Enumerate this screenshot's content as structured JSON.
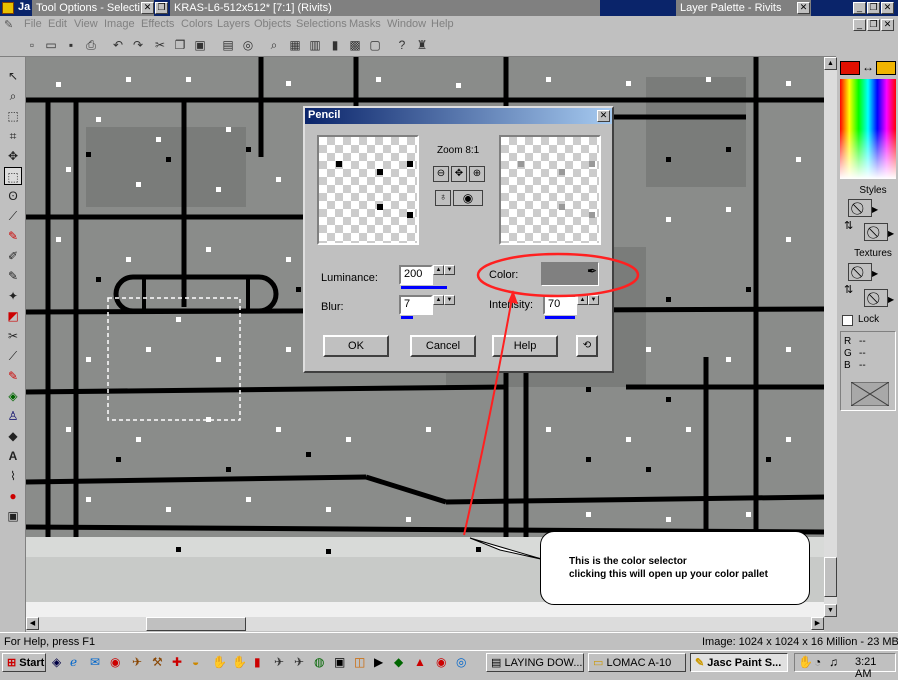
{
  "app_title": "Ja",
  "tool_options_title": "Tool Options - Selecti",
  "document_title": "KRAS-L6-512x512* [7:1] (Rivits)",
  "layer_palette_title": "Layer Palette - Rivits",
  "menu": [
    "File",
    "Edit",
    "View",
    "Image",
    "Effects",
    "Colors",
    "Layers",
    "Objects",
    "Selections",
    "Masks",
    "Window",
    "Help"
  ],
  "palette": {
    "styles_label": "Styles",
    "textures_label": "Textures",
    "lock_label": "Lock",
    "rgb_labels": [
      "R",
      "G",
      "B"
    ],
    "rgb_values": [
      "--",
      "--",
      "--"
    ],
    "foreground_color": "#e01000",
    "background_color": "#f0b400"
  },
  "dialog": {
    "title": "Pencil",
    "zoom_label": "Zoom 8:1",
    "luminance_label": "Luminance:",
    "luminance_value": "200",
    "blur_label": "Blur:",
    "blur_value": "7",
    "color_label": "Color:",
    "intensity_label": "Intensity:",
    "intensity_value": "70",
    "swatch_color": "#808080",
    "ok_label": "OK",
    "cancel_label": "Cancel",
    "help_label": "Help"
  },
  "callout": {
    "line1": "This is the color selector",
    "line2": "clicking this will open up your color pallet"
  },
  "status": {
    "help_text": "For Help, press F1",
    "image_info": "Image:  1024 x 1024 x 16 Million - 23 MBytes"
  },
  "taskbar": {
    "start_label": "Start",
    "tasks": [
      "LAYING DOW...",
      "LOMAC A-10",
      "Jasc Paint S..."
    ],
    "clock": "3:21 AM"
  }
}
